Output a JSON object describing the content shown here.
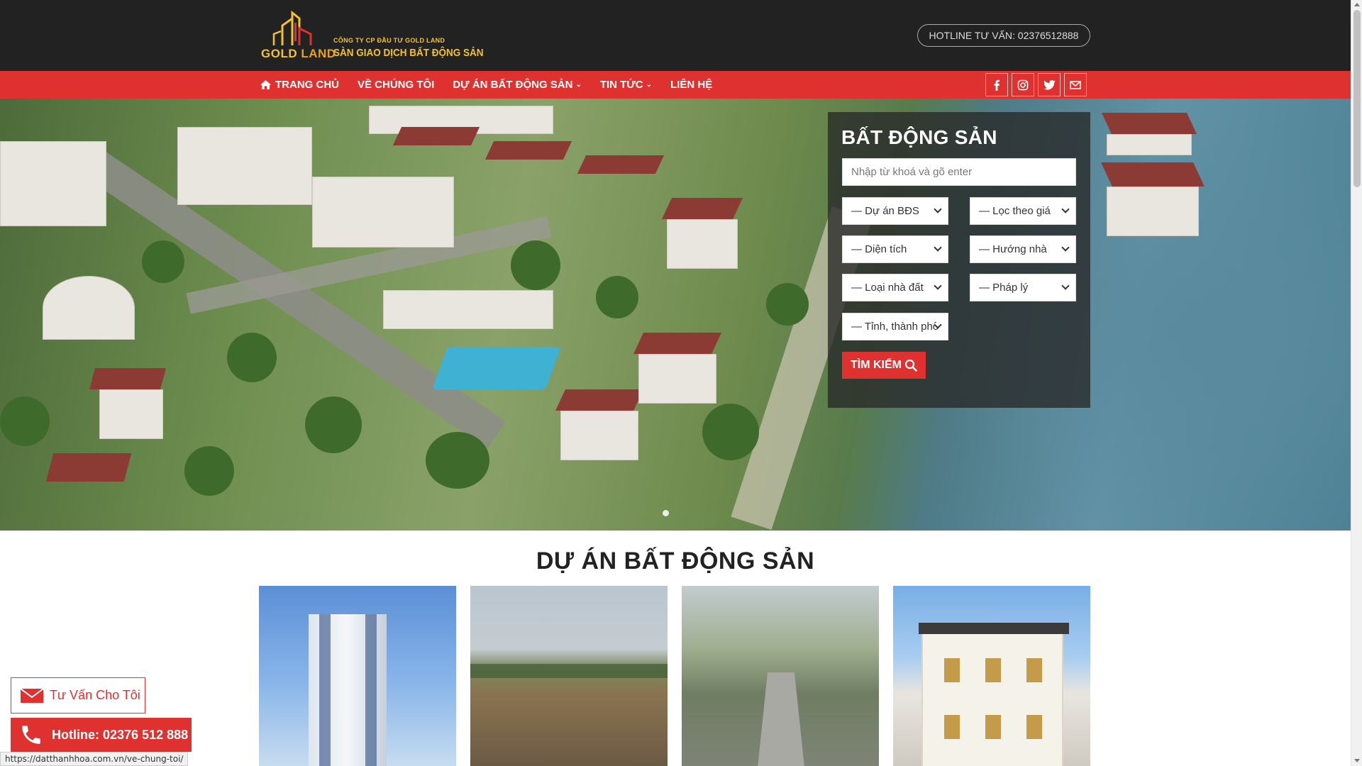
{
  "header": {
    "logo": {
      "brand_word1": "GOLD",
      "brand_word2": "LAND",
      "company_line": "CÔNG TY CP ĐẦU TƯ GOLD LAND",
      "tagline": "SÀN GIAO DỊCH BẤT ĐỘNG SẢN"
    },
    "hotline_pill": "HOTLINE TƯ VẤN: 02376512888"
  },
  "nav": {
    "items": [
      {
        "label": "TRANG CHỦ",
        "icon": "home-icon"
      },
      {
        "label": "VỀ CHÚNG TÔI"
      },
      {
        "label": "DỰ ÁN BẤT ĐỘNG SẢN",
        "has_dropdown": true
      },
      {
        "label": "TIN TỨC",
        "has_dropdown": true
      },
      {
        "label": "LIÊN HỆ"
      }
    ],
    "social": [
      "facebook-icon",
      "instagram-icon",
      "twitter-icon",
      "email-icon"
    ]
  },
  "search": {
    "title": "BẤT ĐỘNG SẢN",
    "placeholder": "Nhập từ khoá và gõ enter",
    "filters": {
      "project": "— Dự án BĐS",
      "price": "— Lọc theo giá",
      "area": "— Diện tích",
      "direction": "— Hướng nhà",
      "type": "— Loại nhà đất",
      "legal": "— Pháp lý",
      "province": "— Tỉnh, thành phố"
    },
    "button_label": "TÌM KIẾM"
  },
  "projects": {
    "title": "DỰ ÁN BẤT ĐỘNG SẢN",
    "cards": [
      {
        "image": "high-rise-tower"
      },
      {
        "image": "empty-land-plot"
      },
      {
        "image": "aerial-road-lots"
      },
      {
        "image": "luxury-villa"
      }
    ]
  },
  "floating": {
    "consult_label": "Tư Vấn Cho Tôi",
    "hotline_label": "Hotline: 02376 512 888"
  },
  "status_bar": {
    "url": "https://datthanhhoa.com.vn/ve-chung-toi/"
  },
  "colors": {
    "header_bg": "#222222",
    "nav_red": "#e03131",
    "gold": "#f2c230"
  }
}
